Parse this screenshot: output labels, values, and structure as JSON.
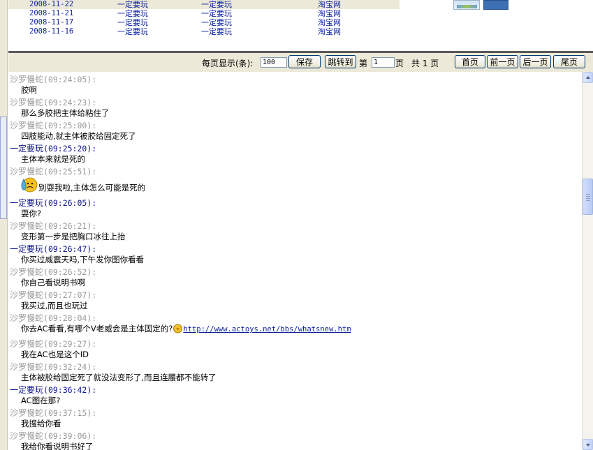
{
  "top_rows": [
    {
      "date": "2008-11-22",
      "col_a": "一定要玩",
      "col_b": "一定要玩",
      "col_c": "淘宝网",
      "selected": true
    },
    {
      "date": "2008-11-21",
      "col_a": "一定要玩",
      "col_b": "一定要玩",
      "col_c": "淘宝网",
      "selected": false
    },
    {
      "date": "2008-11-17",
      "col_a": "一定要玩",
      "col_b": "一定要玩",
      "col_c": "淘宝网",
      "selected": false
    },
    {
      "date": "2008-11-16",
      "col_a": "一定要玩",
      "col_b": "一定要玩",
      "col_c": "淘宝网",
      "selected": false
    }
  ],
  "pager": {
    "per_page_label": "每页显示(条):",
    "per_page_value": "100",
    "save": "保存",
    "goto": "跳转到",
    "page_prefix": "第",
    "page_value": "1",
    "page_suffix": "页",
    "total": "共 1 页",
    "first": "首页",
    "prev": "前一页",
    "next": "后一页",
    "last": "尾页"
  },
  "colors": {
    "other": "#9a9a9a",
    "me": "#0c148c",
    "link": "#0a1f9e"
  },
  "messages": [
    {
      "sender": "沙罗慢蛇",
      "time": "(09:24:05):",
      "self": false,
      "text": "胶啊"
    },
    {
      "sender": "沙罗慢蛇",
      "time": "(09:24:23):",
      "self": false,
      "text": "那么多胶把主体给粘住了"
    },
    {
      "sender": "沙罗慢蛇",
      "time": "(09:25:00):",
      "self": false,
      "text": "四肢能动,就主体被胶给固定死了"
    },
    {
      "sender": "一定要玩",
      "time": "(09:25:20):",
      "self": true,
      "text": "主体本来就是死的"
    },
    {
      "sender": "沙罗慢蛇",
      "time": "(09:25:51):",
      "self": false,
      "text": "别耍我啦,主体怎么可能是死的",
      "emoji": "sweat-face-icon"
    },
    {
      "sender": "一定要玩",
      "time": "(09:26:05):",
      "self": true,
      "text": "耍你?"
    },
    {
      "sender": "沙罗慢蛇",
      "time": "(09:26:21):",
      "self": false,
      "text": "变形第一步是把胸口冰往上抬"
    },
    {
      "sender": "一定要玩",
      "time": "(09:26:47):",
      "self": true,
      "text": "你买过威震天吗,下午发你图你看看"
    },
    {
      "sender": "沙罗慢蛇",
      "time": "(09:26:52):",
      "self": false,
      "text": "你自己看说明书啊"
    },
    {
      "sender": "沙罗慢蛇",
      "time": "(09:27:07):",
      "self": false,
      "text": "我买过,而且也玩过"
    },
    {
      "sender": "沙罗慢蛇",
      "time": "(09:28:04):",
      "self": false,
      "text": "你去AC看看,有哪个V老威会是主体固定的?",
      "emoji2": "bulb-face-icon",
      "link": "http://www.actoys.net/bbs/whatsnew.htm"
    },
    {
      "sender": "沙罗慢蛇",
      "time": "(09:29:27):",
      "self": false,
      "text": "我在AC也是这个ID"
    },
    {
      "sender": "沙罗慢蛇",
      "time": "(09:32:24):",
      "self": false,
      "text": "主体被胶给固定死了就没法变形了,而且连腰都不能转了"
    },
    {
      "sender": "一定要玩",
      "time": "(09:36:42):",
      "self": true,
      "text": "AC图在那?"
    },
    {
      "sender": "沙罗慢蛇",
      "time": "(09:37:15):",
      "self": false,
      "text": "我搜给你看"
    },
    {
      "sender": "沙罗慢蛇",
      "time": "(09:39:06):",
      "self": false,
      "text": "我给你看说明书好了"
    }
  ]
}
